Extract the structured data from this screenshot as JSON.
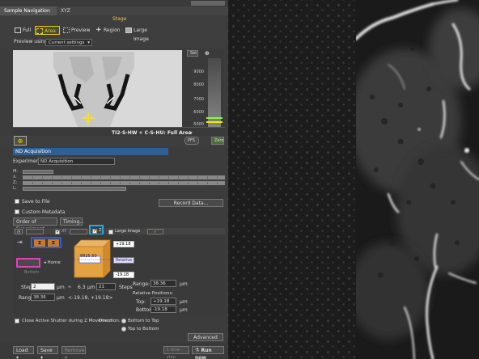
{
  "tabs": [
    {
      "label": "Sample Navigation"
    },
    {
      "label": "XYZ Overview"
    }
  ],
  "stage": {
    "section_label": "Stage",
    "buttons": [
      {
        "label": "Full"
      },
      {
        "label": "Area"
      },
      {
        "label": "Preview"
      },
      {
        "label": "Region"
      },
      {
        "label": "Large Image"
      }
    ],
    "preview_label": "Preview using:",
    "preview_value": "Current settings",
    "set_label": "Set",
    "z_ticks": [
      "9000",
      "8000",
      "7000",
      "6000",
      "5000"
    ],
    "footer_text": "TI2-S-HW + C-S-HU: Full Area",
    "pfs_label": "PFS",
    "zero_label": "Zero"
  },
  "nd": {
    "header": "ND Acquisition",
    "experiment_label": "Experiment:",
    "experiment_value": "ND Acquisition",
    "loop_labels": [
      "M:",
      "λ:",
      "Z:",
      "L:"
    ],
    "save_to_file": "Save to File",
    "record_data": "Record Data...",
    "custom_metadata": "Custom Metadata",
    "order_label": "Order of Experiment",
    "timing_label": "Timing...",
    "xy_label": "XY",
    "z_label": "Z",
    "large_image_label": "Large Image"
  },
  "zstack": {
    "val_top": "+19.18",
    "val_center": "-19.18",
    "relative_label": "Relative",
    "stage_pos": "8825.50",
    "home_label": "Home",
    "bottom_label": "Bottom",
    "step_label": "Step:",
    "step_value": "2",
    "step_unit": "µm",
    "approx_value": "6.3",
    "approx_unit": "µm",
    "steps_value": "21",
    "steps_label": "Steps",
    "range_label": "Range:",
    "range_value": "38.36",
    "range_unit": "µm",
    "range_extent": "<-19.18, +19.18>",
    "range2_label": "Range:",
    "range2_value": "38.36",
    "range2_unit": "µm",
    "relative_positions": "Relative Positions:",
    "top_label": "Top:",
    "top_value": "+19.18",
    "top_unit": "µm",
    "bottom2_label": "Bottom:",
    "bottom2_value": "-19.18",
    "bottom2_unit": "µm",
    "close_shutter": "Close Active Shutter during Z Movement",
    "direction_label": "Direction:",
    "dir_option1": "Bottom to Top",
    "dir_option2": "Top to Bottom",
    "advanced": "Advanced >>"
  },
  "bottom": {
    "load": "Load",
    "save": "Save",
    "remove": "Remove",
    "one_time": "1 time step",
    "run_now": "Run now"
  }
}
